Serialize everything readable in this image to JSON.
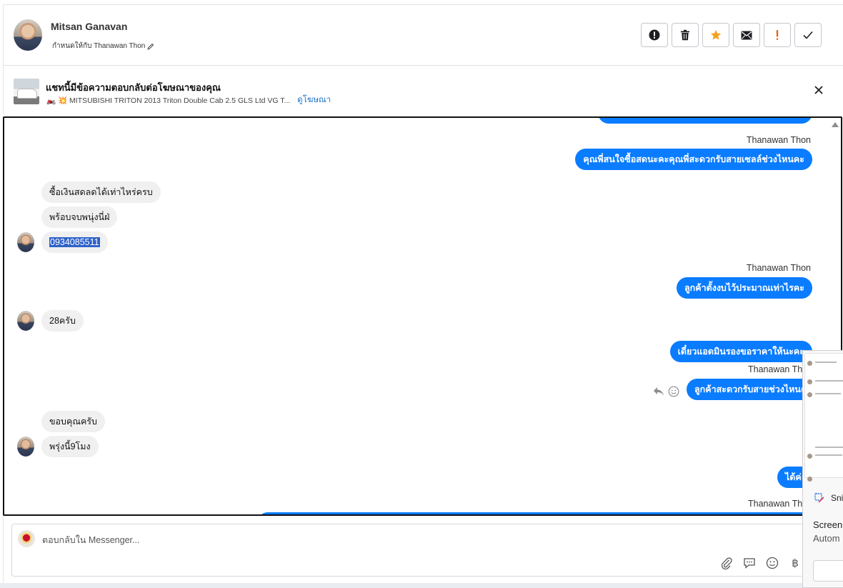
{
  "header": {
    "contact_name": "Mitsan Ganavan",
    "assigned_text": "กำหนดให้กับ Thanawan Thon",
    "actions": [
      "mark-spam",
      "delete",
      "star",
      "mark-unread",
      "follow-up",
      "done"
    ]
  },
  "ad": {
    "title": "แชทนี้มีข้อความตอบกลับต่อโฆษณาของคุณ",
    "description": "🏍️ 💥 MITSUBISHI TRITON 2013 Triton Double Cab 2.5 GLS Ltd VG T...",
    "link_label": "ดูโฆษณา"
  },
  "conversation": {
    "messages": [
      {
        "dir": "out",
        "sender": "Thanawan Thon",
        "text": "คุณพี่สนใจซื้อสดนะคะคุณพี่สะดวกรับสายเซลล์ช่วงไหนคะ"
      },
      {
        "dir": "in",
        "text": "ซื้อเงินสดลดได้เท่าไหร่ครบ"
      },
      {
        "dir": "in",
        "text": "พร้อบจบพนุ่งนี่ฝ่"
      },
      {
        "dir": "in",
        "text": "0934085511",
        "highlighted": true
      },
      {
        "dir": "out",
        "sender": "Thanawan Thon",
        "text": "ลูกค้าตั้งงบไว้ประมาณเท่าไรคะ"
      },
      {
        "dir": "in",
        "text": "28ครับ"
      },
      {
        "dir": "out",
        "text": "เดี๋ยวแอดมินรองขอราคาให้นะคะ"
      },
      {
        "dir": "out",
        "sender": "Thanawan Thon",
        "text": "ลูกค้าสะดวกรับสายช่วงไหนคะ"
      },
      {
        "dir": "in",
        "text": "ขอบคุณครับ"
      },
      {
        "dir": "in",
        "text": "พรุ่งนี้9โมง"
      },
      {
        "dir": "out",
        "text": "ได้ค่ะ"
      },
      {
        "dir": "out",
        "sender": "Thanawan Thon",
        "text": ""
      }
    ]
  },
  "composer": {
    "placeholder": "ตอบกลับใน Messenger...",
    "icons": [
      "paperclip-icon",
      "saved-reply-icon",
      "emoji-icon",
      "baht-icon"
    ],
    "baht_symbol": "฿"
  },
  "snipping_overlay": {
    "app_label": "Sni",
    "line1": "Screen",
    "line2": "Autom"
  },
  "colors": {
    "outgoing_bubble": "#0a7cff",
    "incoming_bubble": "#f0f0f0",
    "star": "#f5a020",
    "follow_up": "#e4670f"
  }
}
